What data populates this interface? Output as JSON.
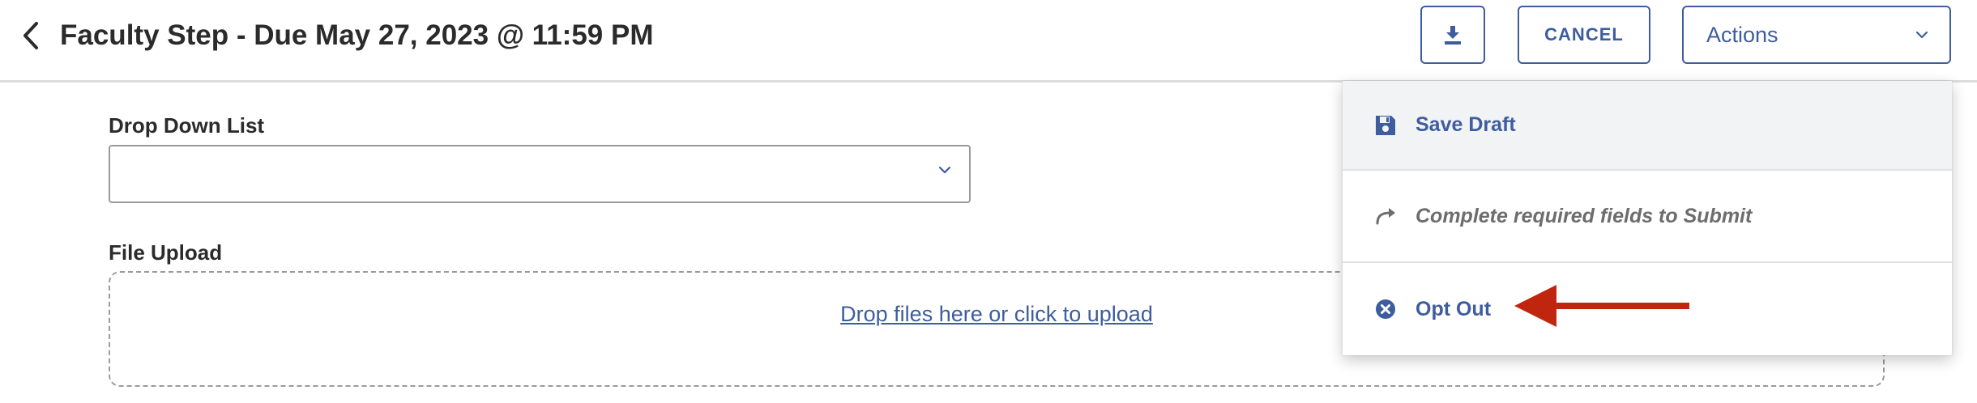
{
  "header": {
    "title": "Faculty Step - Due May 27, 2023 @ 11:59 PM",
    "back_icon": "chevron-left-icon",
    "download_icon": "download-icon",
    "cancel_label": "CANCEL",
    "actions_label": "Actions",
    "actions_icon": "chevron-down-icon"
  },
  "form": {
    "dropdown_label": "Drop Down List",
    "dropdown_value": "",
    "file_upload_label": "File Upload",
    "upload_text": "Drop files here or click to upload"
  },
  "actions_menu": {
    "items": [
      {
        "label": "Save Draft",
        "icon": "floppy-disk-icon",
        "enabled": true
      },
      {
        "label": "Complete required fields to Submit",
        "icon": "share-arrow-icon",
        "enabled": false
      },
      {
        "label": "Opt Out",
        "icon": "circle-x-icon",
        "enabled": true
      }
    ]
  },
  "annotation": {
    "type": "arrow",
    "target": "Opt Out",
    "color": "#c0260d"
  },
  "colors": {
    "accent": "#3e5d9e",
    "title_text": "#2b2b2b",
    "disabled_text": "#6d6d6d",
    "menu_highlight": "#f2f3f5",
    "annotation_red": "#c0260d"
  }
}
